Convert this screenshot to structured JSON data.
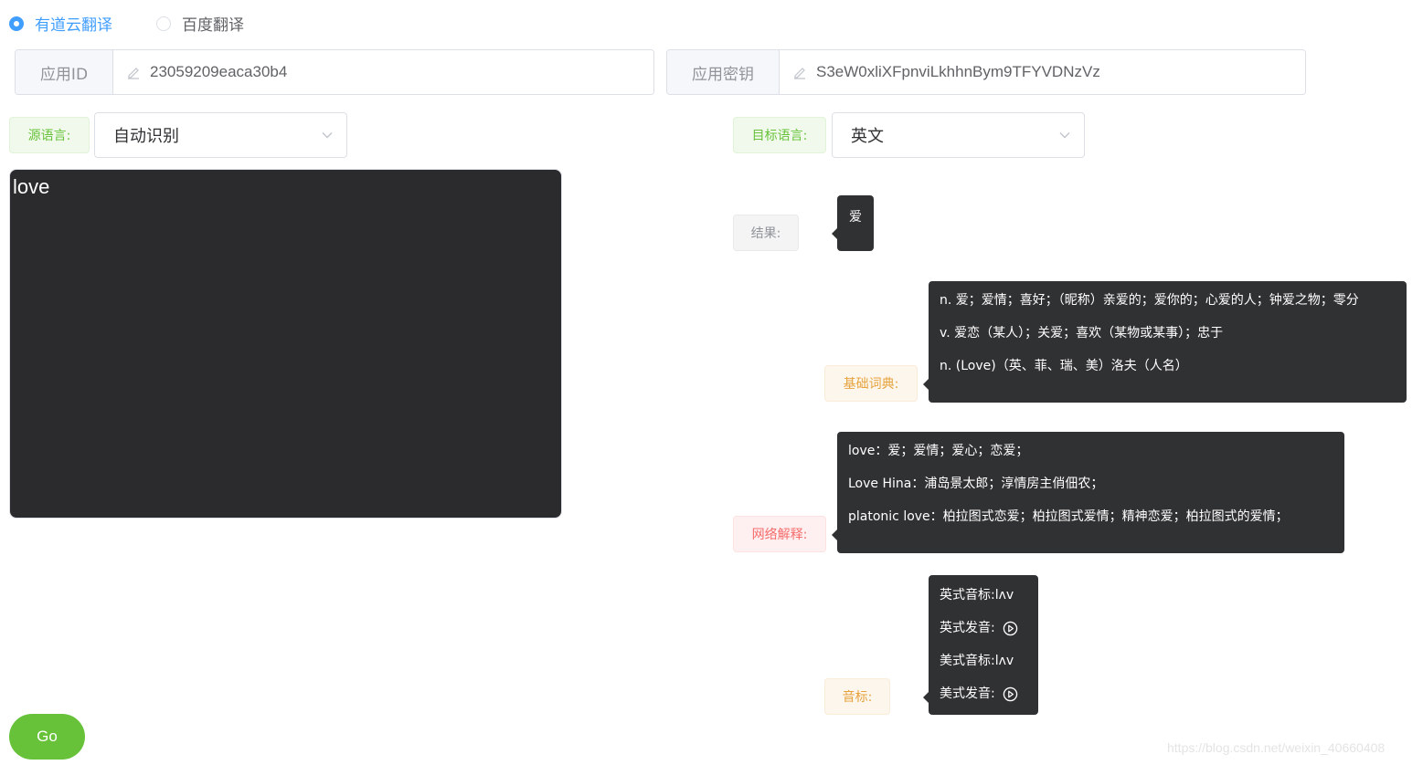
{
  "translator": {
    "options": [
      {
        "label": "有道云翻译",
        "checked": true
      },
      {
        "label": "百度翻译",
        "checked": false
      }
    ]
  },
  "credentials": {
    "app_id_label": "应用ID",
    "app_id_value": "23059209eaca30b4",
    "app_key_label": "应用密钥",
    "app_key_value": "S3eW0xliXFpnviLkhhnBym9TFYVDNzVz"
  },
  "source": {
    "label": "源语言:",
    "selected": "自动识别",
    "text": "love"
  },
  "target": {
    "label": "目标语言:",
    "selected": "英文"
  },
  "result": {
    "label": "结果:",
    "value": "爱"
  },
  "basic_dict": {
    "label": "基础词典:",
    "lines": [
      "n. 爱；爱情；喜好；（昵称）亲爱的；爱你的；心爱的人；钟爱之物；零分",
      "v. 爱恋（某人）；关爱；喜欢（某物或某事）；忠于",
      "n. (Love)（英、菲、瑞、美）洛夫（人名）"
    ]
  },
  "web_explain": {
    "label": "网络解释:",
    "lines": [
      "love：爱；爱情；爱心；恋爱；",
      "Love Hina：浦岛景太郎；淳情房主俏佃农；",
      "platonic love：柏拉图式恋爱；柏拉图式爱情；精神恋爱；柏拉图式的爱情；"
    ]
  },
  "phonetic": {
    "label": "音标:",
    "uk_phonetic_label": "英式音标:",
    "uk_phonetic_value": "lʌv",
    "uk_audio_label": "英式发音:",
    "us_phonetic_label": "美式音标:",
    "us_phonetic_value": "lʌv",
    "us_audio_label": "美式发音:"
  },
  "go_button": "Go",
  "watermark": "https://blog.csdn.net/weixin_40660408",
  "colors": {
    "primary": "#409eff",
    "success": "#67c23a",
    "warning": "#e6a23c",
    "danger": "#f56c6c",
    "dark": "#303133"
  },
  "icons": {
    "edit": "edit-icon",
    "chevron": "chevron-down-icon",
    "play": "play-circle-icon"
  }
}
